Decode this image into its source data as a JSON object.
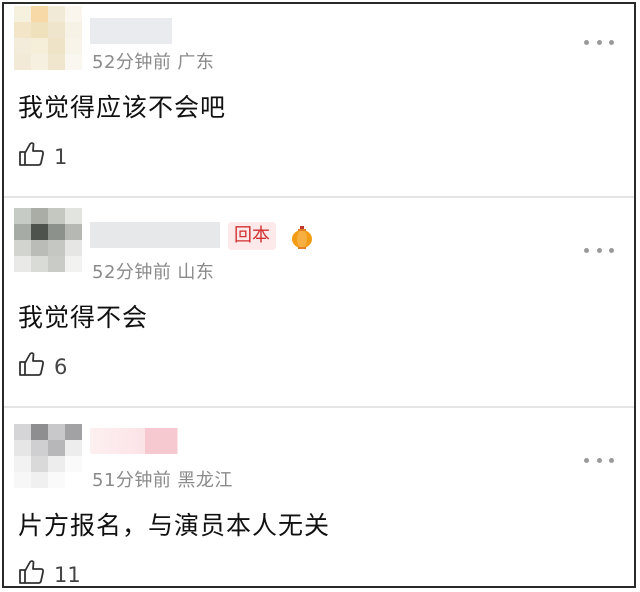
{
  "comments": [
    {
      "time": "52分钟前",
      "location": "广东",
      "text": "我觉得应该不会吧",
      "likes": "1",
      "avatar_colors": [
        "#f6f0df",
        "#f7d9a8",
        "#f1ead7",
        "#faf6ee",
        "#f3e6c8",
        "#f0e1bd",
        "#efe5cc",
        "#f7f2e6",
        "#f4ecda",
        "#f5eed9",
        "#eee3c6",
        "#f8f4ea",
        "#f2ead6",
        "#f6f0e1",
        "#f0e6ce",
        "#faf7f0"
      ],
      "name_blur_color": "#e9ebee"
    },
    {
      "time": "52分钟前",
      "location": "山东",
      "text": "我觉得不会",
      "likes": "6",
      "badge": "回本",
      "avatar_colors": [
        "#c7cbc5",
        "#a9ada6",
        "#c4c8c1",
        "#e2e4e0",
        "#a7aba5",
        "#4e534e",
        "#8c918b",
        "#b5b8b3",
        "#d2d4d0",
        "#b9bcb7",
        "#c5c8c2",
        "#e6e7e4",
        "#e9eae8",
        "#d9dbd7",
        "#c8cbc6",
        "#f2f2f1"
      ],
      "name_blur_color": "#e7e8ea"
    },
    {
      "time": "51分钟前",
      "location": "黑龙江",
      "text": "片方报名，与演员本人无关",
      "likes": "11",
      "avatar_colors": [
        "#d5d5d7",
        "#8e8e91",
        "#c8c8ca",
        "#a2a2a5",
        "#e6e6e7",
        "#cfcfd1",
        "#b7b7b9",
        "#ededee",
        "#f2f2f2",
        "#d9d9da",
        "#ededee",
        "#fafafa",
        "#f7f7f7",
        "#f0f0f1",
        "#fafafa",
        "#ffffff"
      ],
      "name_blur_color": "#fbe7ea"
    }
  ],
  "icons": {
    "like": "thumbs-up-icon",
    "more": "more-dots-icon",
    "lantern": "lantern-icon"
  },
  "colors": {
    "accent_red": "#d0302f",
    "badge_bg": "#fde9e9",
    "meta_gray": "#8a8a8a"
  }
}
